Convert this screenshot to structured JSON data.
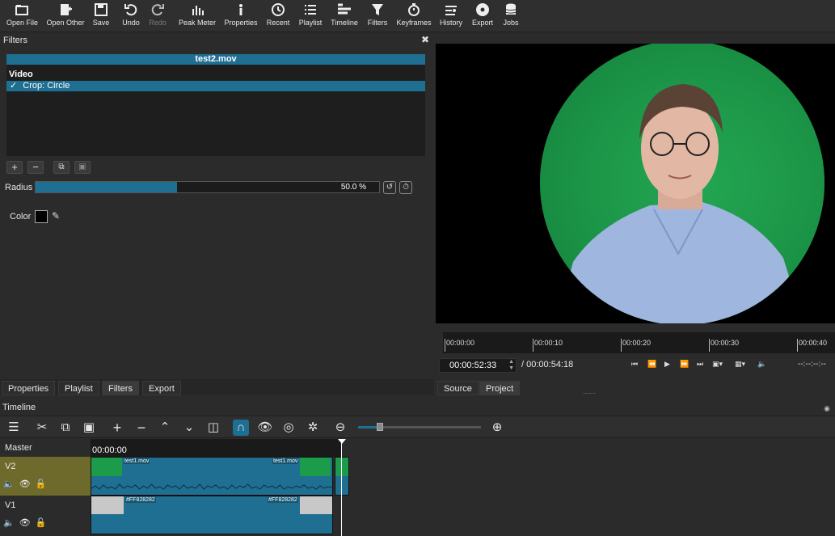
{
  "toolbar": {
    "open_file": "Open File",
    "open_other": "Open Other",
    "save": "Save",
    "undo": "Undo",
    "redo": "Redo",
    "peak_meter": "Peak Meter",
    "properties": "Properties",
    "recent": "Recent",
    "playlist": "Playlist",
    "timeline": "Timeline",
    "filters": "Filters",
    "keyframes": "Keyframes",
    "history": "History",
    "export": "Export",
    "jobs": "Jobs"
  },
  "filters_panel": {
    "title": "Filters",
    "clip_name": "test2.mov",
    "section": "Video",
    "filter_item": "Crop: Circle",
    "checkmark": "✓",
    "radius_label": "Radius",
    "radius_value": "50.0 %",
    "radius_fraction": 0.5,
    "color_label": "Color",
    "color_value": "#000000"
  },
  "left_tabs": [
    "Properties",
    "Playlist",
    "Filters",
    "Export"
  ],
  "player": {
    "ruler_ticks": [
      "00:00:00",
      "00:00:10",
      "00:00:20",
      "00:00:30",
      "00:00:40"
    ],
    "current_time": "00:00:52:33",
    "total_time": "/ 00:00:54:18",
    "end_placeholder": "--:--:--:--",
    "tabs": [
      "Source",
      "Project"
    ]
  },
  "timeline": {
    "title": "Timeline",
    "ruler_time": "00:00:00",
    "master_label": "Master",
    "tracks": [
      {
        "name": "V2",
        "clip_labels": [
          "test1.mov",
          "test1.mov"
        ]
      },
      {
        "name": "V1",
        "clip_labels": [
          "#FF828282",
          "#FF828282"
        ]
      }
    ]
  },
  "colors": {
    "accent": "#1f6f92",
    "v2_header": "#6e6a2c",
    "chroma_green": "#1c9b4a"
  }
}
